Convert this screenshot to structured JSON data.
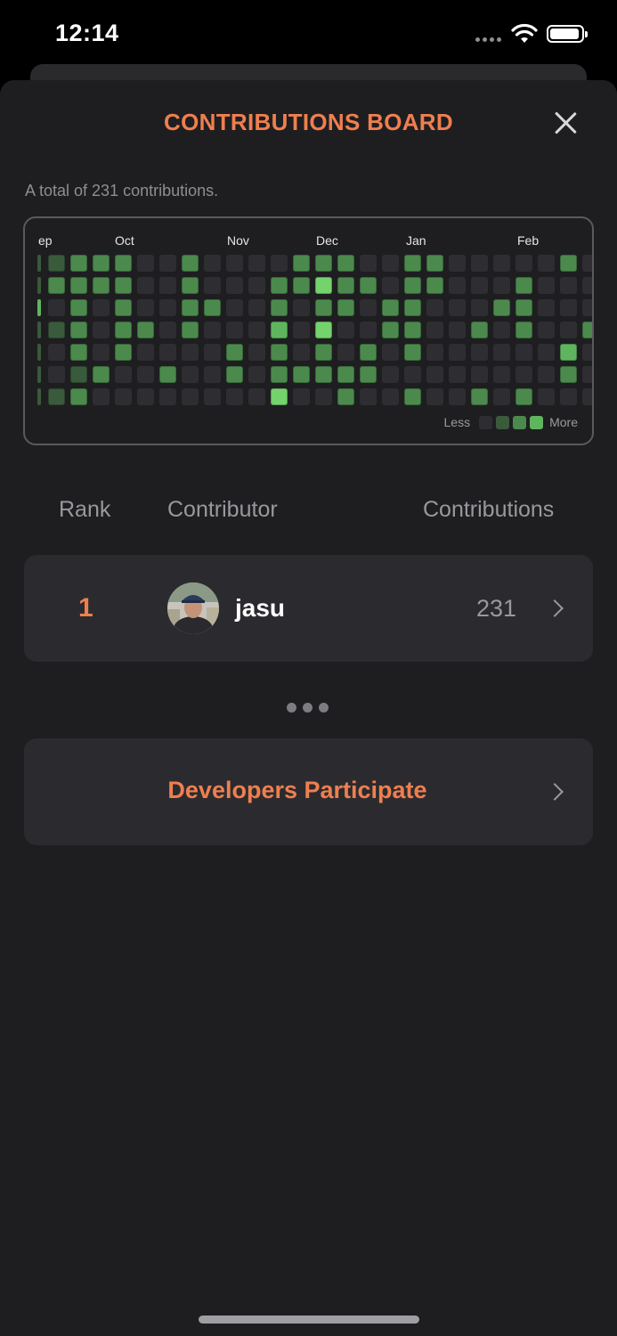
{
  "status_bar": {
    "time": "12:14"
  },
  "sheet": {
    "title": "CONTRIBUTIONS BOARD"
  },
  "summary": {
    "total_text": "A total of 231 contributions."
  },
  "heatmap": {
    "months": [
      "ep",
      "Oct",
      "Nov",
      "Dec",
      "Jan",
      "Feb"
    ],
    "legend": {
      "less": "Less",
      "more": "More"
    },
    "colors": [
      "#2e2e32",
      "#3a5a3c",
      "#4b8a4c",
      "#5fb55e",
      "#74d36c"
    ],
    "levels": [
      [
        1,
        2,
        0,
        1,
        0,
        0,
        1
      ],
      [
        2,
        2,
        2,
        2,
        2,
        1,
        2
      ],
      [
        2,
        2,
        0,
        0,
        0,
        2,
        0
      ],
      [
        2,
        2,
        2,
        2,
        2,
        0,
        0
      ],
      [
        0,
        0,
        0,
        2,
        0,
        0,
        0
      ],
      [
        0,
        0,
        0,
        0,
        0,
        2,
        0
      ],
      [
        2,
        2,
        2,
        2,
        0,
        0,
        0
      ],
      [
        0,
        0,
        2,
        0,
        0,
        0,
        0
      ],
      [
        0,
        0,
        0,
        0,
        2,
        2,
        0
      ],
      [
        0,
        0,
        0,
        0,
        0,
        0,
        0
      ],
      [
        0,
        2,
        2,
        3,
        2,
        2,
        4
      ],
      [
        2,
        2,
        0,
        0,
        0,
        2,
        0
      ],
      [
        2,
        4,
        2,
        4,
        2,
        2,
        0
      ],
      [
        2,
        2,
        2,
        0,
        0,
        2,
        2
      ],
      [
        0,
        2,
        0,
        0,
        2,
        2,
        0
      ],
      [
        0,
        0,
        2,
        2,
        0,
        0,
        0
      ],
      [
        2,
        2,
        2,
        2,
        2,
        0,
        2
      ],
      [
        2,
        2,
        0,
        0,
        0,
        0,
        0
      ],
      [
        0,
        0,
        0,
        0,
        0,
        0,
        0
      ],
      [
        0,
        0,
        0,
        2,
        0,
        0,
        2
      ],
      [
        0,
        0,
        2,
        0,
        0,
        0,
        0
      ],
      [
        0,
        2,
        2,
        2,
        0,
        0,
        2
      ],
      [
        0,
        0,
        0,
        0,
        0,
        0,
        0
      ],
      [
        2,
        0,
        0,
        0,
        3,
        2,
        0
      ],
      [
        0,
        0,
        0,
        2,
        0,
        0,
        0
      ],
      [
        2,
        0,
        0,
        0,
        2,
        0,
        2
      ],
      [
        2,
        2,
        0,
        2,
        0,
        0,
        0
      ]
    ]
  },
  "table": {
    "headers": {
      "rank": "Rank",
      "contributor": "Contributor",
      "contributions": "Contributions"
    },
    "rows": [
      {
        "rank": "1",
        "name": "jasu",
        "count": "231"
      }
    ]
  },
  "developers": {
    "label": "Developers Participate"
  }
}
